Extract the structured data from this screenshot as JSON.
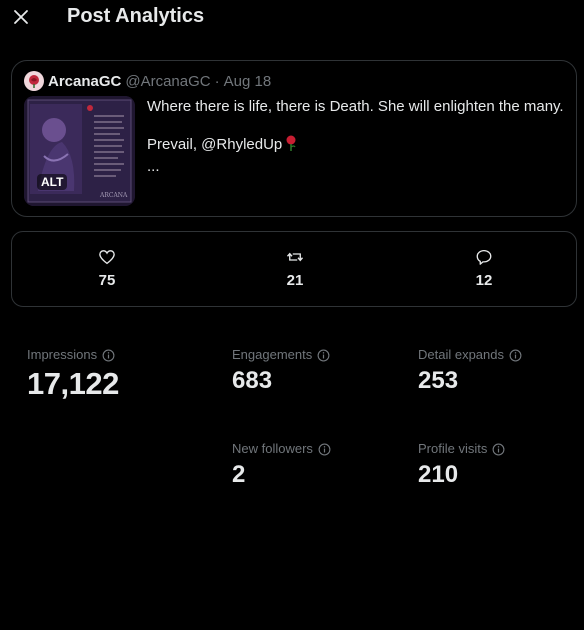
{
  "header": {
    "title": "Post Analytics"
  },
  "tweet": {
    "author_name": "ArcanaGC",
    "author_handle": "@ArcanaGC",
    "separator": "·",
    "date": "Aug 18",
    "text_line1": "Where there is life, there is Death. She will enlighten the many.",
    "text_line2": "Prevail, @RhyledUp",
    "ellipsis": "...",
    "media_alt_badge": "ALT",
    "media_caption": "ARCANA"
  },
  "engagement": {
    "likes": "75",
    "retweets": "21",
    "replies": "12"
  },
  "stats": {
    "impressions": {
      "label": "Impressions",
      "value": "17,122"
    },
    "engagements": {
      "label": "Engagements",
      "value": "683"
    },
    "detail_expands": {
      "label": "Detail expands",
      "value": "253"
    },
    "new_followers": {
      "label": "New followers",
      "value": "2"
    },
    "profile_visits": {
      "label": "Profile visits",
      "value": "210"
    }
  },
  "icons": {
    "close": "close-icon",
    "like": "heart-icon",
    "retweet": "retweet-icon",
    "reply": "reply-icon",
    "info": "info-icon",
    "rose": "rose-emoji"
  },
  "colors": {
    "background": "#000000",
    "text_primary": "#e7e9ea",
    "text_secondary": "#71767b",
    "border": "#2f3336"
  }
}
